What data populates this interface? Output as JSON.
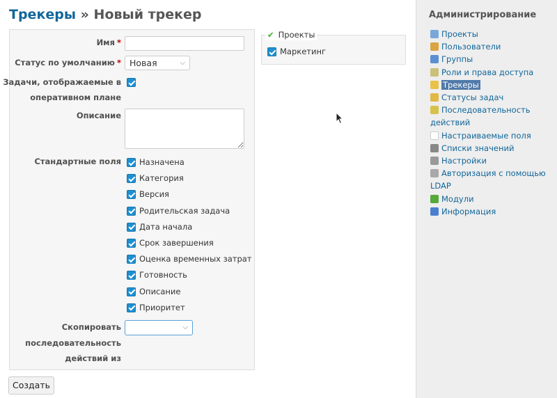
{
  "page": {
    "breadcrumb_link": "Трекеры",
    "breadcrumb_sep": "»",
    "title": "Новый трекер"
  },
  "form": {
    "name_label": "Имя",
    "required_mark": "*",
    "name_value": "",
    "default_status_label": "Статус по умолчанию",
    "default_status_value": "Новая",
    "roadmap_label_line1": "Задачи, отображаемые в",
    "roadmap_label_line2": "оперативном плане",
    "roadmap_checked": true,
    "description_label": "Описание",
    "description_value": "",
    "standard_fields_label": "Стандартные поля",
    "standard_fields": [
      {
        "label": "Назначена",
        "checked": true
      },
      {
        "label": "Категория",
        "checked": true
      },
      {
        "label": "Версия",
        "checked": true
      },
      {
        "label": "Родительская задача",
        "checked": true
      },
      {
        "label": "Дата начала",
        "checked": true
      },
      {
        "label": "Срок завершения",
        "checked": true
      },
      {
        "label": "Оценка временных затрат",
        "checked": true
      },
      {
        "label": "Готовность",
        "checked": true
      },
      {
        "label": "Описание",
        "checked": true
      },
      {
        "label": "Приоритет",
        "checked": true
      }
    ],
    "copy_workflow_line1": "Скопировать",
    "copy_workflow_line2": "последовательность",
    "copy_workflow_line3": "действий из",
    "copy_workflow_value": "",
    "submit_label": "Создать"
  },
  "projects": {
    "legend": "Проекты",
    "legend_icon": "checkmark-icon",
    "items": [
      {
        "label": "Маркетинг",
        "checked": true
      }
    ]
  },
  "sidebar": {
    "title": "Администрирование",
    "items": [
      {
        "label": "Проекты",
        "icon": "projects-icon",
        "color": "#7aa7d9"
      },
      {
        "label": "Пользователи",
        "icon": "user-icon",
        "color": "#d9a441"
      },
      {
        "label": "Группы",
        "icon": "group-icon",
        "color": "#5b8fd1"
      },
      {
        "label": "Роли и права доступа",
        "icon": "roles-icon",
        "color": "#c9c07a"
      },
      {
        "label": "Трекеры",
        "icon": "tracker-icon",
        "color": "#e8c24a",
        "selected": true
      },
      {
        "label": "Статусы задач",
        "icon": "issue-status-icon",
        "color": "#e0b846"
      },
      {
        "label": "Последовательность",
        "label_line2": "действий",
        "icon": "workflow-icon",
        "color": "#d6c24a"
      },
      {
        "label": "Настраиваемые поля",
        "icon": "custom-fields-icon",
        "color": "#ffffff"
      },
      {
        "label": "Списки значений",
        "icon": "list-icon",
        "color": "#888888"
      },
      {
        "label": "Настройки",
        "icon": "settings-icon",
        "color": "#999999"
      },
      {
        "label": "Авторизация с помощью",
        "label_line2": "LDAP",
        "icon": "ldap-icon",
        "color": "#a9a9a9"
      },
      {
        "label": "Модули",
        "icon": "plugins-icon",
        "color": "#55a83a"
      },
      {
        "label": "Информация",
        "icon": "info-icon",
        "color": "#4a7fcf"
      }
    ]
  },
  "colors": {
    "link": "#116699",
    "selected_bg": "#507aaa",
    "checkbox": "#1f8fd0",
    "required": "#bb0000"
  }
}
